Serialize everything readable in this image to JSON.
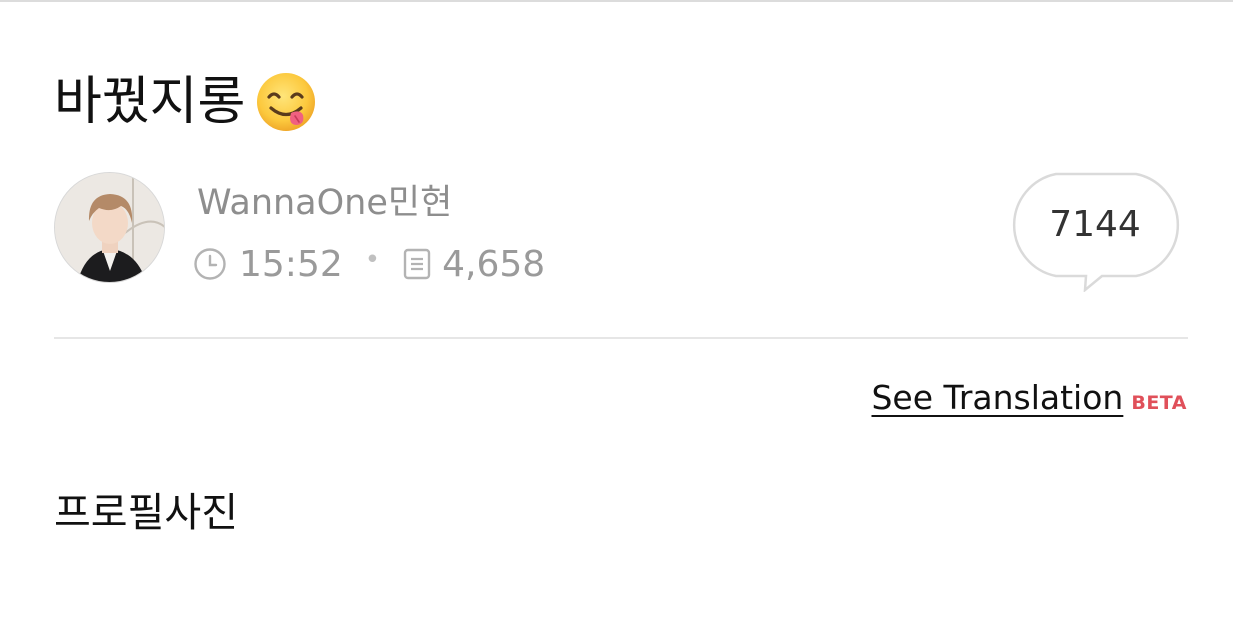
{
  "post": {
    "title": "바꿨지롱",
    "title_emoji": "face-savoring-food-emoji",
    "author": "WannaOne민현",
    "time": "15:52",
    "views": "4,658",
    "comments": "7144",
    "body": "프로필사진"
  },
  "translation": {
    "link_label": "See Translation",
    "badge": "BETA"
  },
  "icons": {
    "time": "clock-icon",
    "views": "document-icon",
    "comments": "speech-bubble-icon"
  },
  "colors": {
    "beta_badge": "#e0505a",
    "meta_text": "#9a9a9a"
  }
}
